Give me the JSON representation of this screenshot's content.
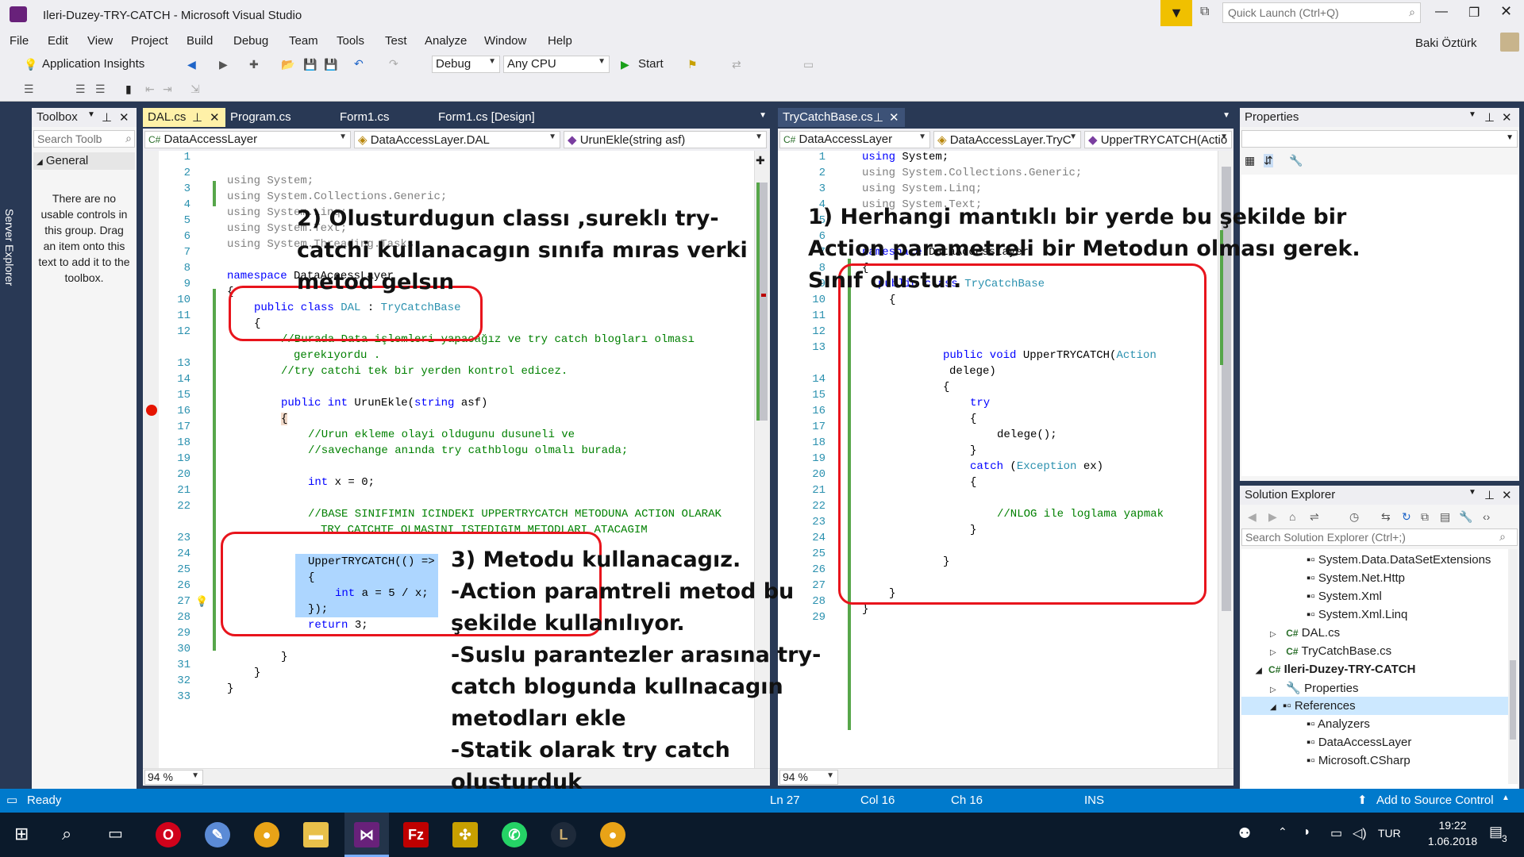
{
  "window": {
    "title": "Ileri-Duzey-TRY-CATCH - Microsoft Visual Studio",
    "quick_launch_placeholder": "Quick Launch (Ctrl+Q)",
    "user": "Baki Öztürk"
  },
  "menu": [
    "File",
    "Edit",
    "View",
    "Project",
    "Build",
    "Debug",
    "Team",
    "Tools",
    "Test",
    "Analyze",
    "Window",
    "Help"
  ],
  "toolbar": {
    "app_insights": "Application Insights",
    "config": "Debug",
    "platform": "Any CPU",
    "start": "Start"
  },
  "toolbox": {
    "title": "Toolbox",
    "search_placeholder": "Search Toolb",
    "group": "General",
    "empty_text": "There are no usable controls in this group. Drag an item onto this text to add it to the toolbox."
  },
  "server_explorer": "Server Explorer",
  "left_editor": {
    "tabs": [
      "DAL.cs",
      "Program.cs",
      "Form1.cs",
      "Form1.cs [Design]"
    ],
    "nav": [
      "DataAccessLayer",
      "DataAccessLayer.DAL",
      "UrunEkle(string asf)"
    ],
    "zoom": "94 %",
    "line_numbers": [
      "1",
      "2",
      "3",
      "4",
      "5",
      "6",
      "7",
      "8",
      "9",
      "10",
      "11",
      "12",
      "",
      "13",
      "14",
      "15",
      "16",
      "17",
      "18",
      "19",
      "20",
      "21",
      "22",
      "",
      "23",
      "24",
      "25",
      "26",
      "27",
      "28",
      "29",
      "30",
      "31",
      "32",
      "33"
    ]
  },
  "right_editor": {
    "tabs": [
      "TryCatchBase.cs"
    ],
    "nav": [
      "DataAccessLayer",
      "DataAccessLayer.TryC",
      "UpperTRYCATCH(Actio"
    ],
    "zoom": "94 %",
    "line_numbers": [
      "1",
      "2",
      "3",
      "4",
      "5",
      "6",
      "7",
      "8",
      "9",
      "10",
      "11",
      "12",
      "13",
      "",
      "14",
      "15",
      "16",
      "17",
      "18",
      "19",
      "20",
      "21",
      "22",
      "23",
      "24",
      "25",
      "26",
      "27",
      "28",
      "29"
    ]
  },
  "annotations": {
    "one": "1) Herhangi mantıklı bir yerde bu şekilde bir\nAction parametreli bir Metodun olması gerek.\nSınıf olustur.",
    "two": "2) Olusturdugun classı ,sureklı try-\ncatchi kullanacagın sınıfa mıras verki\nmetod gelsın",
    "three": "3) Metodu kullanacagız.\n-Action paramtreli metod bu\nşekilde kullanılıyor.\n-Suslu parantezler arasına try-\ncatch blogunda kullnacagın\nmetodları ekle\n-Statik olarak try catch\nolusturduk"
  },
  "properties": {
    "title": "Properties"
  },
  "solution_explorer": {
    "title": "Solution Explorer",
    "search_placeholder": "Search Solution Explorer (Ctrl+;)",
    "items": [
      "System.Data.DataSetExtensions",
      "System.Net.Http",
      "System.Xml",
      "System.Xml.Linq",
      "DAL.cs",
      "TryCatchBase.cs",
      "Ileri-Duzey-TRY-CATCH",
      "Properties",
      "References",
      "Analyzers",
      "DataAccessLayer",
      "Microsoft.CSharp"
    ]
  },
  "status": {
    "ready": "Ready",
    "ln": "Ln 27",
    "col": "Col 16",
    "ch": "Ch 16",
    "ins": "INS",
    "source_control": "Add to Source Control"
  },
  "taskbar": {
    "lang": "TUR",
    "time": "19:22",
    "date": "1.06.2018",
    "notifications": "3"
  }
}
